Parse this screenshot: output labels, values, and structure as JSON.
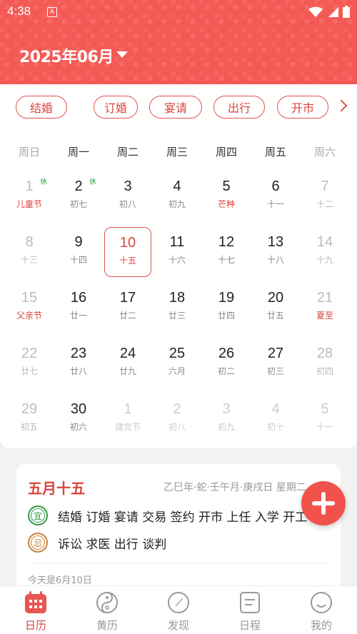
{
  "status": {
    "time": "4:38",
    "app_badge": "A"
  },
  "header": {
    "month_title": "2025年06月"
  },
  "chips": [
    "结婚",
    "订婚",
    "宴请",
    "出行",
    "开市"
  ],
  "weekdays": [
    "周日",
    "周一",
    "周二",
    "周三",
    "周四",
    "周五",
    "周六"
  ],
  "days": [
    {
      "n": "1",
      "s": "儿童节",
      "red": true,
      "badge": "休"
    },
    {
      "n": "2",
      "s": "初七",
      "badge": "休"
    },
    {
      "n": "3",
      "s": "初八"
    },
    {
      "n": "4",
      "s": "初九"
    },
    {
      "n": "5",
      "s": "芒种",
      "red": true
    },
    {
      "n": "6",
      "s": "十一"
    },
    {
      "n": "7",
      "s": "十二"
    },
    {
      "n": "8",
      "s": "十三"
    },
    {
      "n": "9",
      "s": "十四"
    },
    {
      "n": "10",
      "s": "十五",
      "today": true
    },
    {
      "n": "11",
      "s": "十六"
    },
    {
      "n": "12",
      "s": "十七"
    },
    {
      "n": "13",
      "s": "十八"
    },
    {
      "n": "14",
      "s": "十九"
    },
    {
      "n": "15",
      "s": "父亲节",
      "red": true
    },
    {
      "n": "16",
      "s": "廿一"
    },
    {
      "n": "17",
      "s": "廿二"
    },
    {
      "n": "18",
      "s": "廿三"
    },
    {
      "n": "19",
      "s": "廿四"
    },
    {
      "n": "20",
      "s": "廿五"
    },
    {
      "n": "21",
      "s": "夏至",
      "red": true
    },
    {
      "n": "22",
      "s": "廿七"
    },
    {
      "n": "23",
      "s": "廿八"
    },
    {
      "n": "24",
      "s": "廿九"
    },
    {
      "n": "25",
      "s": "六月"
    },
    {
      "n": "26",
      "s": "初二"
    },
    {
      "n": "27",
      "s": "初三"
    },
    {
      "n": "28",
      "s": "初四"
    },
    {
      "n": "29",
      "s": "初五"
    },
    {
      "n": "30",
      "s": "初六"
    },
    {
      "n": "1",
      "s": "建党节",
      "other": true
    },
    {
      "n": "2",
      "s": "初八",
      "other": true
    },
    {
      "n": "3",
      "s": "初九",
      "other": true
    },
    {
      "n": "4",
      "s": "初十",
      "other": true
    },
    {
      "n": "5",
      "s": "十一",
      "other": true
    }
  ],
  "info": {
    "lunar_date": "五月十五",
    "ganzhi": "乙巳年·蛇·壬午月·庚戌日 星期二",
    "yi_seal": "宜",
    "yi_text": "结婚 订婚 宴请 交易 签约 开市 上任 入学 开工",
    "ji_seal": "忌",
    "ji_text": "诉讼 求医 出行 谈判",
    "today_text": "今天是6月10日"
  },
  "tabs": [
    {
      "label": "日历",
      "icon": "calendar-icon",
      "active": true
    },
    {
      "label": "黄历",
      "icon": "taiji-icon"
    },
    {
      "label": "发现",
      "icon": "compass-icon"
    },
    {
      "label": "日程",
      "icon": "schedule-icon"
    },
    {
      "label": "我的",
      "icon": "profile-icon"
    }
  ],
  "colors": {
    "brand": "#f45a55",
    "accent": "#d8453f",
    "yi": "#3a9a48",
    "ji": "#c9843c",
    "holiday_badge": "#3aa84a"
  }
}
